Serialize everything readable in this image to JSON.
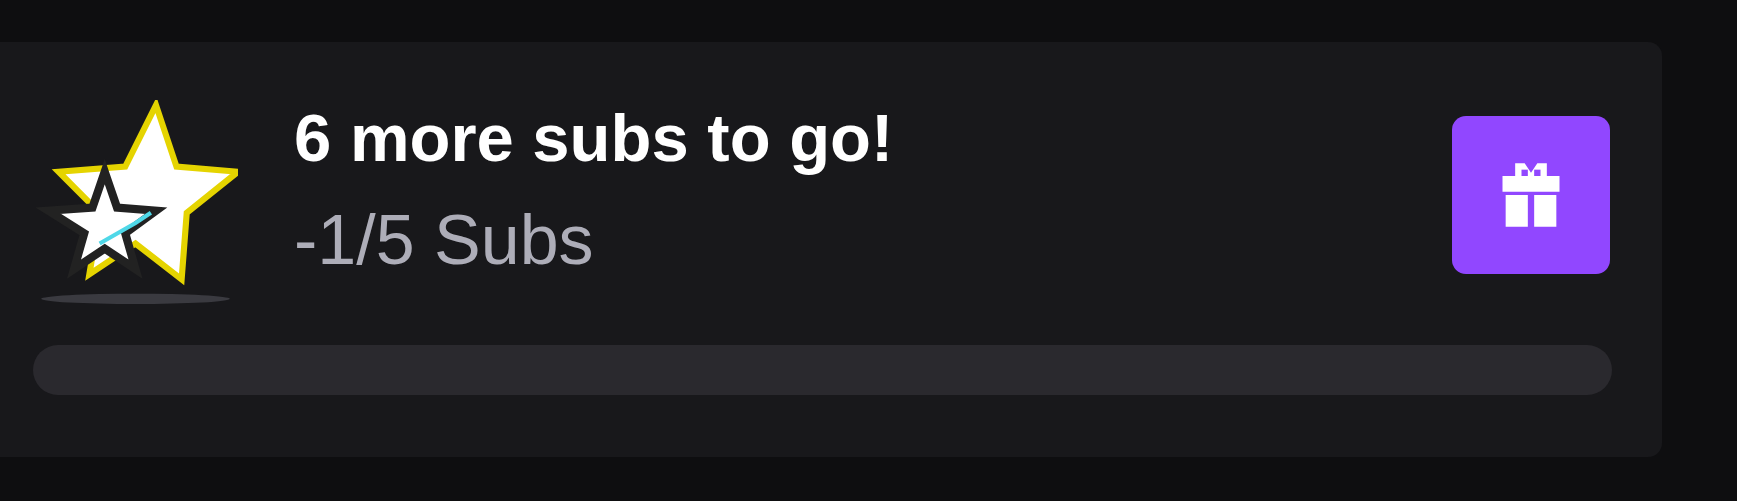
{
  "goal": {
    "title": "6 more subs to go!",
    "subtitle": "-1/5 Subs",
    "progress": {
      "level": 0
    }
  }
}
